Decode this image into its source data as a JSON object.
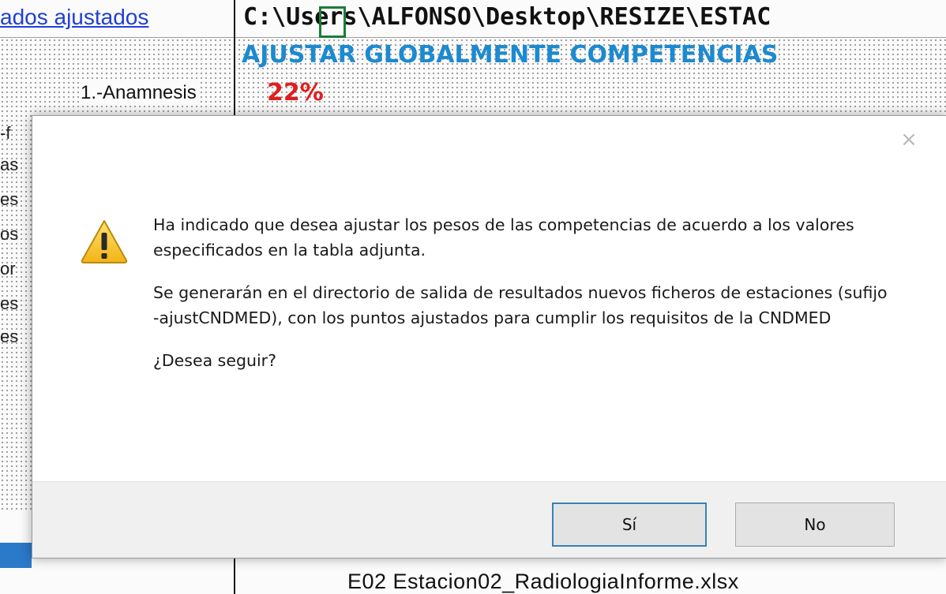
{
  "sheet": {
    "link_text": "ados ajustados",
    "path_text": "C:\\Users\\ALFONSO\\Desktop\\RESIZE\\ESTAC",
    "heading": "AJUSTAR GLOBALMENTE COMPETENCIAS",
    "row_label": "1.-Anamnesis",
    "row_value": "22%",
    "edge_fragments": [
      "-f",
      "as",
      "es",
      "os",
      "or",
      "es",
      "es"
    ],
    "bottom_row": "E02    Estacion02_RadiologiaInforme.xlsx"
  },
  "dialog": {
    "close_glyph": "×",
    "message_lines": [
      "Ha indicado que desea ajustar los pesos de las competencias de acuerdo a los valores especificados en la tabla adjunta.",
      "Se generarán en el directorio de salida de resultados nuevos ficheros de estaciones (sufijo -ajustCNDMED), con los puntos ajustados para cumplir los requisitos de la CNDMED",
      "¿Desea seguir?"
    ],
    "yes_label": "Sí",
    "no_label": "No",
    "icon": "warning-icon"
  }
}
